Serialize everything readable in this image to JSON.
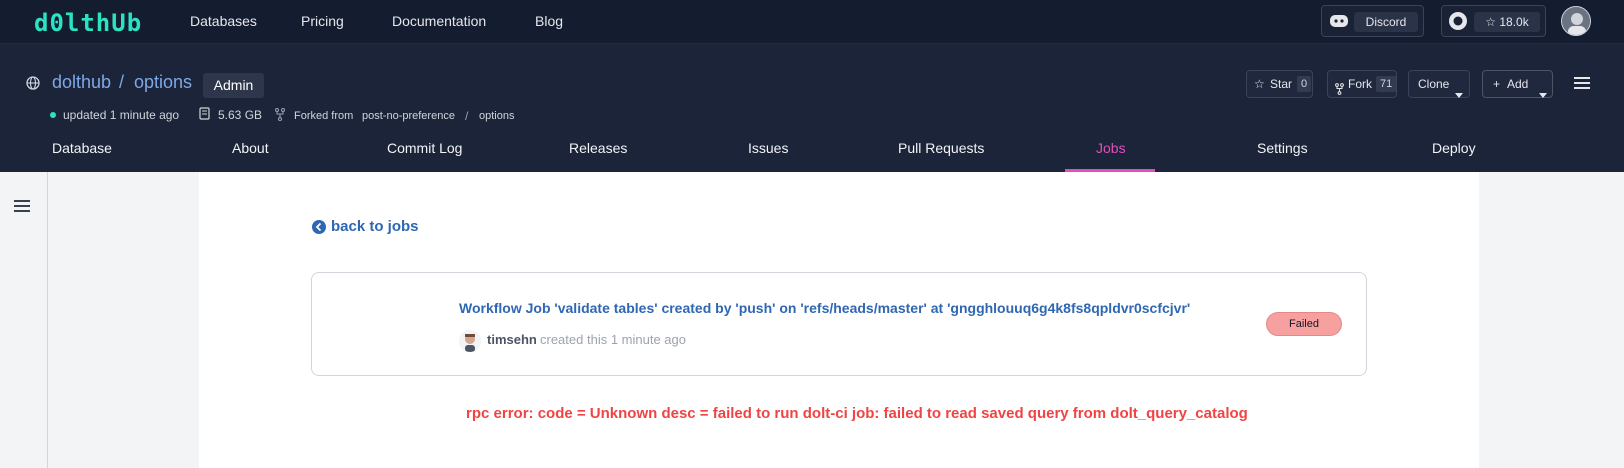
{
  "topnav": {
    "logo": "d0lthUb",
    "links": [
      "Databases",
      "Pricing",
      "Documentation",
      "Blog"
    ],
    "discord_label": "Discord",
    "github_stars": "18.0k",
    "star_glyph": "☆"
  },
  "repo": {
    "owner": "dolthub",
    "separator": "/",
    "name": "options",
    "badge": "Admin",
    "updated": "updated 1 minute ago",
    "size": "5.63 GB",
    "forked_from_label": "Forked from",
    "forked_owner": "post-no-preference",
    "forked_sep": "/",
    "forked_repo": "options",
    "actions": {
      "star_label": "Star",
      "star_count": "0",
      "fork_label": "Fork",
      "fork_count": "71",
      "clone_label": "Clone",
      "add_label": "Add"
    }
  },
  "tabs": [
    {
      "label": "Database"
    },
    {
      "label": "About"
    },
    {
      "label": "Commit Log"
    },
    {
      "label": "Releases"
    },
    {
      "label": "Issues"
    },
    {
      "label": "Pull Requests"
    },
    {
      "label": "Jobs",
      "active": true
    },
    {
      "label": "Settings"
    },
    {
      "label": "Deploy"
    }
  ],
  "job": {
    "back_label": "back to jobs",
    "title": "Workflow Job 'validate tables' created by 'push' on 'refs/heads/master' at 'gngghlouuq6g4k8fs8qpldvr0scfcjvr'",
    "user": "timsehn",
    "created": "created this 1 minute ago",
    "status": "Failed",
    "error": "rpc error: code = Unknown desc = failed to run dolt-ci job: failed to read saved query from dolt_query_catalog"
  },
  "colors": {
    "accent": "#29e3c1",
    "active_tab": "#e24fb9",
    "link": "#2f67b2",
    "error": "#f04444",
    "status_failed": "#f6a0a0"
  }
}
